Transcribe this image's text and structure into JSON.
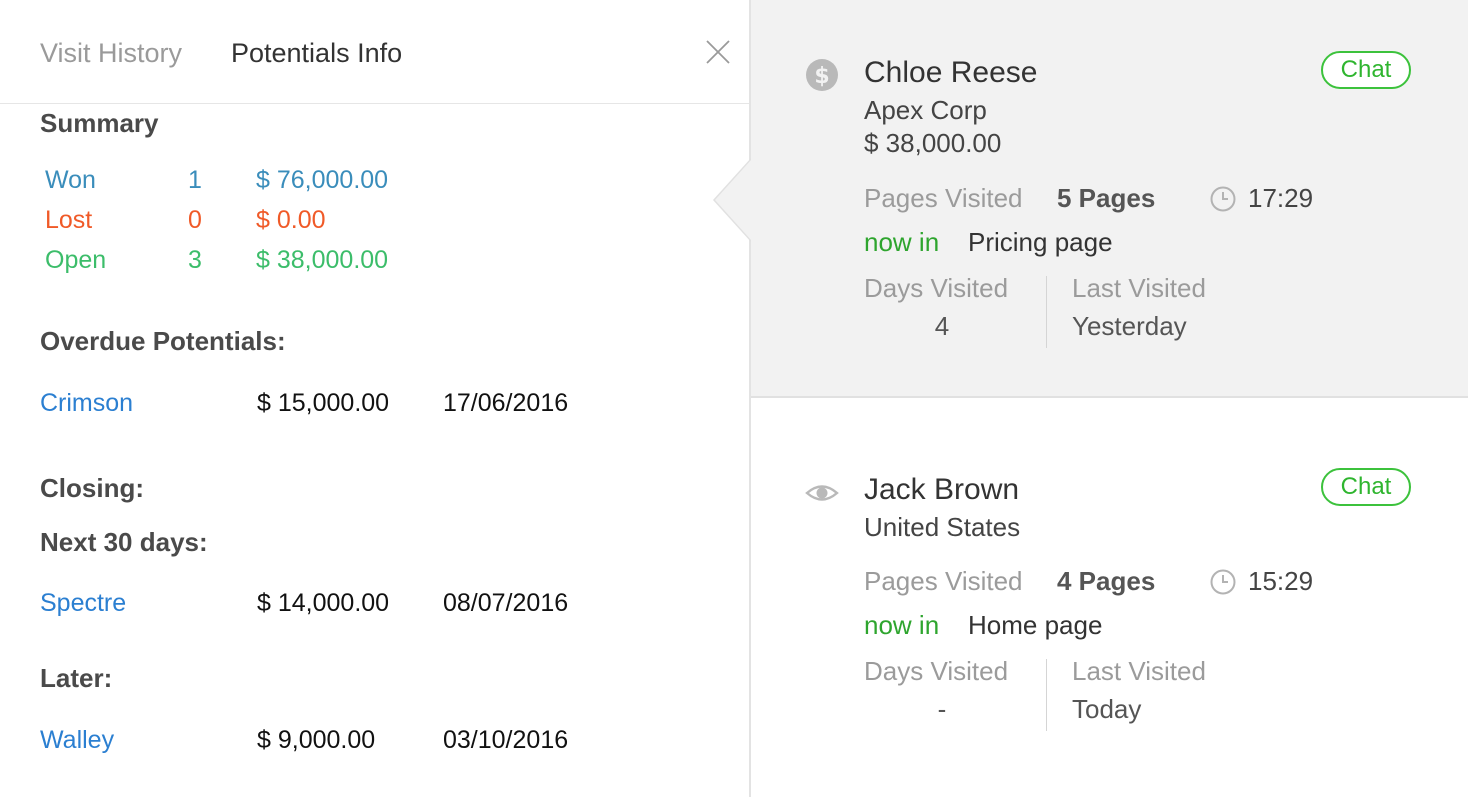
{
  "tabs": {
    "visit_history": "Visit History",
    "potentials_info": "Potentials Info"
  },
  "summary": {
    "title": "Summary",
    "rows": [
      {
        "label": "Won",
        "count": "1",
        "amount": "$ 76,000.00",
        "color": "#3a8dbb"
      },
      {
        "label": "Lost",
        "count": "0",
        "amount": "$ 0.00",
        "color": "#f05a28"
      },
      {
        "label": "Open",
        "count": "3",
        "amount": "$ 38,000.00",
        "color": "#3cbd6a"
      }
    ]
  },
  "overdue": {
    "title": "Overdue Potentials:",
    "items": [
      {
        "name": "Crimson",
        "amount": "$ 15,000.00",
        "date": "17/06/2016"
      }
    ]
  },
  "closing": {
    "title": "Closing:",
    "next30": {
      "title": "Next 30 days:",
      "items": [
        {
          "name": "Spectre",
          "amount": "$ 14,000.00",
          "date": "08/07/2016"
        }
      ]
    },
    "later": {
      "title": "Later:",
      "items": [
        {
          "name": "Walley",
          "amount": "$ 9,000.00",
          "date": "03/10/2016"
        }
      ]
    }
  },
  "visitors": [
    {
      "name": "Chloe Reese",
      "company": "Apex Corp",
      "amount": "$ 38,000.00",
      "icon": "dollar-icon",
      "chat_label": "Chat",
      "pages_visited_label": "Pages Visited",
      "pages_visited": "5 Pages",
      "time": "17:29",
      "now_in_label": "now in",
      "now_in_page": "Pricing page",
      "days_visited_label": "Days Visited",
      "days_visited": "4",
      "last_visited_label": "Last Visited",
      "last_visited": "Yesterday"
    },
    {
      "name": "Jack Brown",
      "company": "United States",
      "icon": "eye-icon",
      "chat_label": "Chat",
      "pages_visited_label": "Pages Visited",
      "pages_visited": "4 Pages",
      "time": "15:29",
      "now_in_label": "now in",
      "now_in_page": "Home page",
      "days_visited_label": "Days Visited",
      "days_visited": "-",
      "last_visited_label": "Last Visited",
      "last_visited": "Today"
    }
  ],
  "colors": {
    "link": "#2b7fd1",
    "chat_green": "#3cc23c",
    "now_in_green": "#2ea52e",
    "selected_card_bg": "#f2f2f2"
  }
}
